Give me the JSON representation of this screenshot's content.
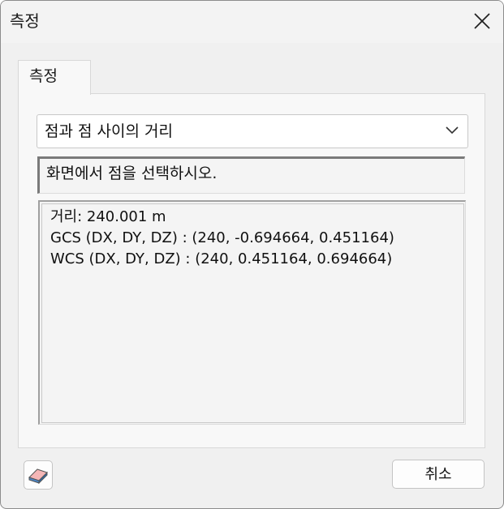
{
  "window": {
    "title": "측정"
  },
  "tabs": [
    {
      "label": "측정",
      "selected": true
    }
  ],
  "measure_mode": {
    "selected": "점과 점 사이의 거리"
  },
  "status": {
    "message": "화면에서 점을 선택하시오."
  },
  "results": {
    "lines": [
      "거리: 240.001 m",
      "GCS (DX, DY, DZ) : (240, -0.694664, 0.451164)",
      "WCS (DX, DY, DZ) : (240, 0.451164, 0.694664)"
    ]
  },
  "footer": {
    "eraser_icon": "eraser-icon",
    "cancel_label": "취소"
  },
  "colors": {
    "window_bg": "#f0f0f0",
    "panel_bg": "#f8f8f8",
    "eraser_pink": "#f4b6b6",
    "eraser_blue": "#4a86c8"
  }
}
